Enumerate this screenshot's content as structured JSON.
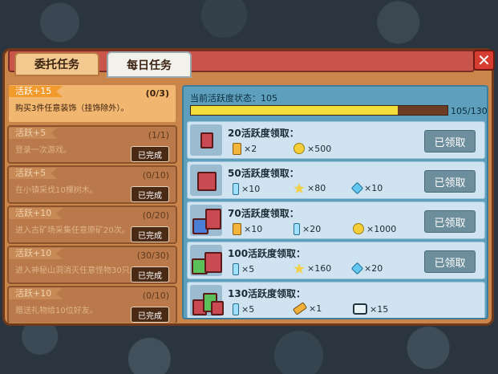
{
  "tabs": [
    {
      "label": "委托任务"
    },
    {
      "label": "每日任务"
    }
  ],
  "close_label": "✕",
  "tasks": [
    {
      "badge": "活跃+15",
      "progress": "(0/3)",
      "desc": "购买3件任意装饰（挂饰除外）。",
      "button": ""
    },
    {
      "badge": "活跃+5",
      "progress": "(1/1)",
      "desc": "登录一次游戏。",
      "button": "已完成"
    },
    {
      "badge": "活跃+5",
      "progress": "(0/10)",
      "desc": "在小镇采伐10棵树木。",
      "button": "已完成"
    },
    {
      "badge": "活跃+10",
      "progress": "(0/20)",
      "desc": "进入古矿场采集任意原矿20次。",
      "button": "已完成"
    },
    {
      "badge": "活跃+10",
      "progress": "(30/30)",
      "desc": "进入神秘山洞消灭任意怪物30只。",
      "button": "已完成"
    },
    {
      "badge": "活跃+10",
      "progress": "(0/10)",
      "desc": "赠送礼物给10位好友。",
      "button": "已完成"
    }
  ],
  "status": {
    "label": "当前活跃度状态：105",
    "value_text": "105/130",
    "current": 105,
    "max": 130
  },
  "rewards": [
    {
      "title": "20活跃度领取：",
      "button": "已领取",
      "items": [
        {
          "icon": "potion-icon",
          "qty": "×2"
        },
        {
          "icon": "coin-icon",
          "qty": "×500"
        }
      ]
    },
    {
      "title": "50活跃度领取：",
      "button": "已领取",
      "items": [
        {
          "icon": "bottle-icon",
          "qty": "×10"
        },
        {
          "icon": "star-icon",
          "qty": "×80"
        },
        {
          "icon": "gem-icon",
          "qty": "×10"
        }
      ]
    },
    {
      "title": "70活跃度领取：",
      "button": "已领取",
      "items": [
        {
          "icon": "potion-icon",
          "qty": "×10"
        },
        {
          "icon": "bottle-icon",
          "qty": "×20"
        },
        {
          "icon": "coin-icon",
          "qty": "×1000"
        }
      ]
    },
    {
      "title": "100活跃度领取：",
      "button": "已领取",
      "items": [
        {
          "icon": "bottle-icon",
          "qty": "×5"
        },
        {
          "icon": "star-icon",
          "qty": "×160"
        },
        {
          "icon": "gem-icon",
          "qty": "×20"
        }
      ]
    },
    {
      "title": "130活跃度领取：",
      "button": "",
      "items": [
        {
          "icon": "bottle-icon",
          "qty": "×5"
        },
        {
          "icon": "ticket-icon",
          "qty": "×1"
        },
        {
          "icon": "tv-icon",
          "qty": "×15"
        }
      ]
    }
  ]
}
